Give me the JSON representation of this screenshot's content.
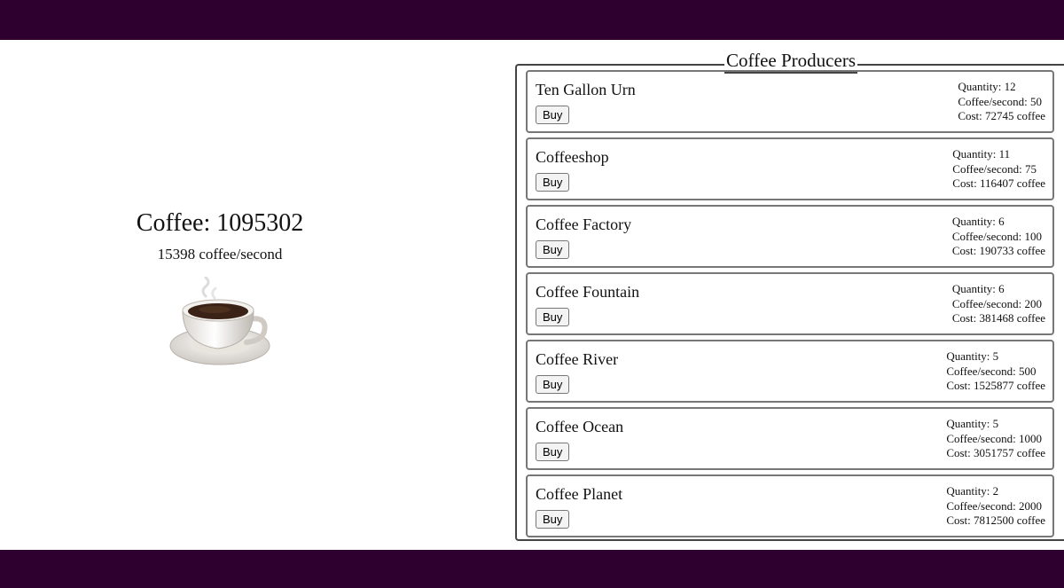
{
  "counter": {
    "coffee_label": "Coffee: 1095302",
    "rate_label": "15398 coffee/second"
  },
  "producers": {
    "title": "Coffee Producers",
    "buy_label": "Buy",
    "items": [
      {
        "name": "Ten Gallon Urn",
        "quantity": "Quantity: 12",
        "cps": "Coffee/second: 50",
        "cost": "Cost: 72745 coffee"
      },
      {
        "name": "Coffeeshop",
        "quantity": "Quantity: 11",
        "cps": "Coffee/second: 75",
        "cost": "Cost: 116407 coffee"
      },
      {
        "name": "Coffee Factory",
        "quantity": "Quantity: 6",
        "cps": "Coffee/second: 100",
        "cost": "Cost: 190733 coffee"
      },
      {
        "name": "Coffee Fountain",
        "quantity": "Quantity: 6",
        "cps": "Coffee/second: 200",
        "cost": "Cost: 381468 coffee"
      },
      {
        "name": "Coffee River",
        "quantity": "Quantity: 5",
        "cps": "Coffee/second: 500",
        "cost": "Cost: 1525877 coffee"
      },
      {
        "name": "Coffee Ocean",
        "quantity": "Quantity: 5",
        "cps": "Coffee/second: 1000",
        "cost": "Cost: 3051757 coffee"
      },
      {
        "name": "Coffee Planet",
        "quantity": "Quantity: 2",
        "cps": "Coffee/second: 2000",
        "cost": "Cost: 7812500 coffee"
      }
    ]
  },
  "icons": {
    "cup": "coffee-cup-icon"
  },
  "colors": {
    "band": "#2d0030"
  }
}
